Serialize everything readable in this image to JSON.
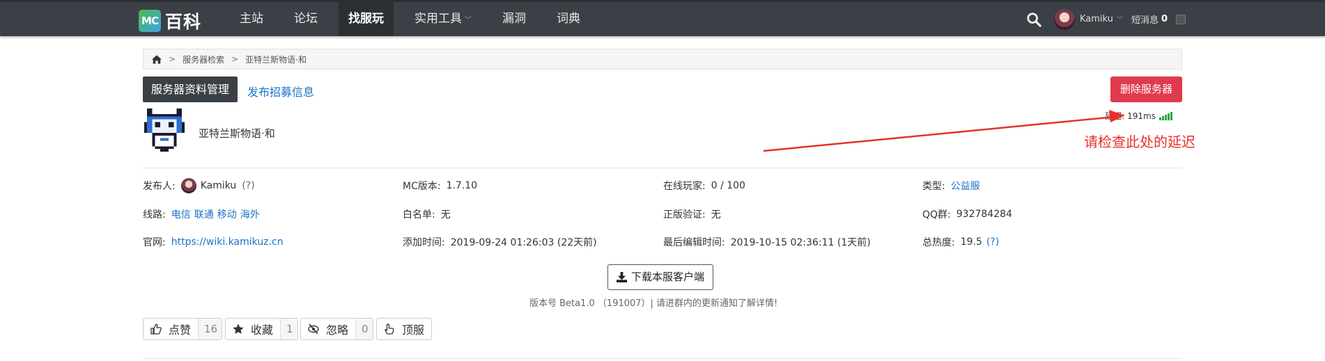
{
  "topbar": {
    "logo_badge": "MC",
    "logo_text": "百科",
    "nav": [
      {
        "label": "主站"
      },
      {
        "label": "论坛"
      },
      {
        "label": "找服玩",
        "active": true
      },
      {
        "label": "实用工具",
        "dropdown": true
      },
      {
        "label": "漏洞"
      },
      {
        "label": "词典"
      }
    ],
    "username": "Kamiku",
    "messages_label": "短消息",
    "messages_count": "0"
  },
  "breadcrumb": {
    "items": [
      "服务器检索",
      "亚特兰斯物语·和"
    ],
    "separator": ">"
  },
  "actions": {
    "manage_label": "服务器资料管理",
    "recruit_label": "发布招募信息",
    "delete_label": "删除服务器"
  },
  "server": {
    "name": "亚特兰斯物语·和",
    "ping_label": "延迟: 191ms",
    "signal_level": 5
  },
  "annotation": {
    "text": "请检查此处的延迟",
    "color": "#e8302a"
  },
  "info": {
    "publisher_label": "发布人:",
    "publisher_name": "Kamiku",
    "publisher_hint": "(?)",
    "mc_version_label": "MC版本:",
    "mc_version": "1.7.10",
    "online_label": "在线玩家:",
    "online": "0 / 100",
    "type_label": "类型:",
    "type": "公益服",
    "route_label": "线路:",
    "routes": [
      "电信",
      "联通",
      "移动",
      "海外"
    ],
    "whitelist_label": "白名单:",
    "whitelist": "无",
    "premium_label": "正版验证:",
    "premium": "无",
    "qq_label": "QQ群:",
    "qq": "932784284",
    "site_label": "官网:",
    "site": "https://wiki.kamikuz.cn",
    "added_label": "添加时间:",
    "added": "2019-09-24 01:26:03 (22天前)",
    "edited_label": "最后编辑时间:",
    "edited": "2019-10-15 02:36:11 (1天前)",
    "heat_label": "总热度:",
    "heat": "19.5",
    "heat_hint": "(?)"
  },
  "download": {
    "label": "下载本服客户端",
    "version_note": "版本号 Beta1.0 （191007）| 请进群内的更新通知了解详情!"
  },
  "social": [
    {
      "label": "点赞",
      "count": "16",
      "icon": "thumbs-up-icon"
    },
    {
      "label": "收藏",
      "count": "1",
      "icon": "star-icon"
    },
    {
      "label": "忽略",
      "count": "0",
      "icon": "eye-slash-icon"
    },
    {
      "label": "顶服",
      "icon": "hand-point-up-icon"
    }
  ],
  "colors": {
    "topbar": "#3b4046",
    "link": "#1a73c9",
    "danger": "#e03a4e",
    "signal": "#28a745"
  }
}
